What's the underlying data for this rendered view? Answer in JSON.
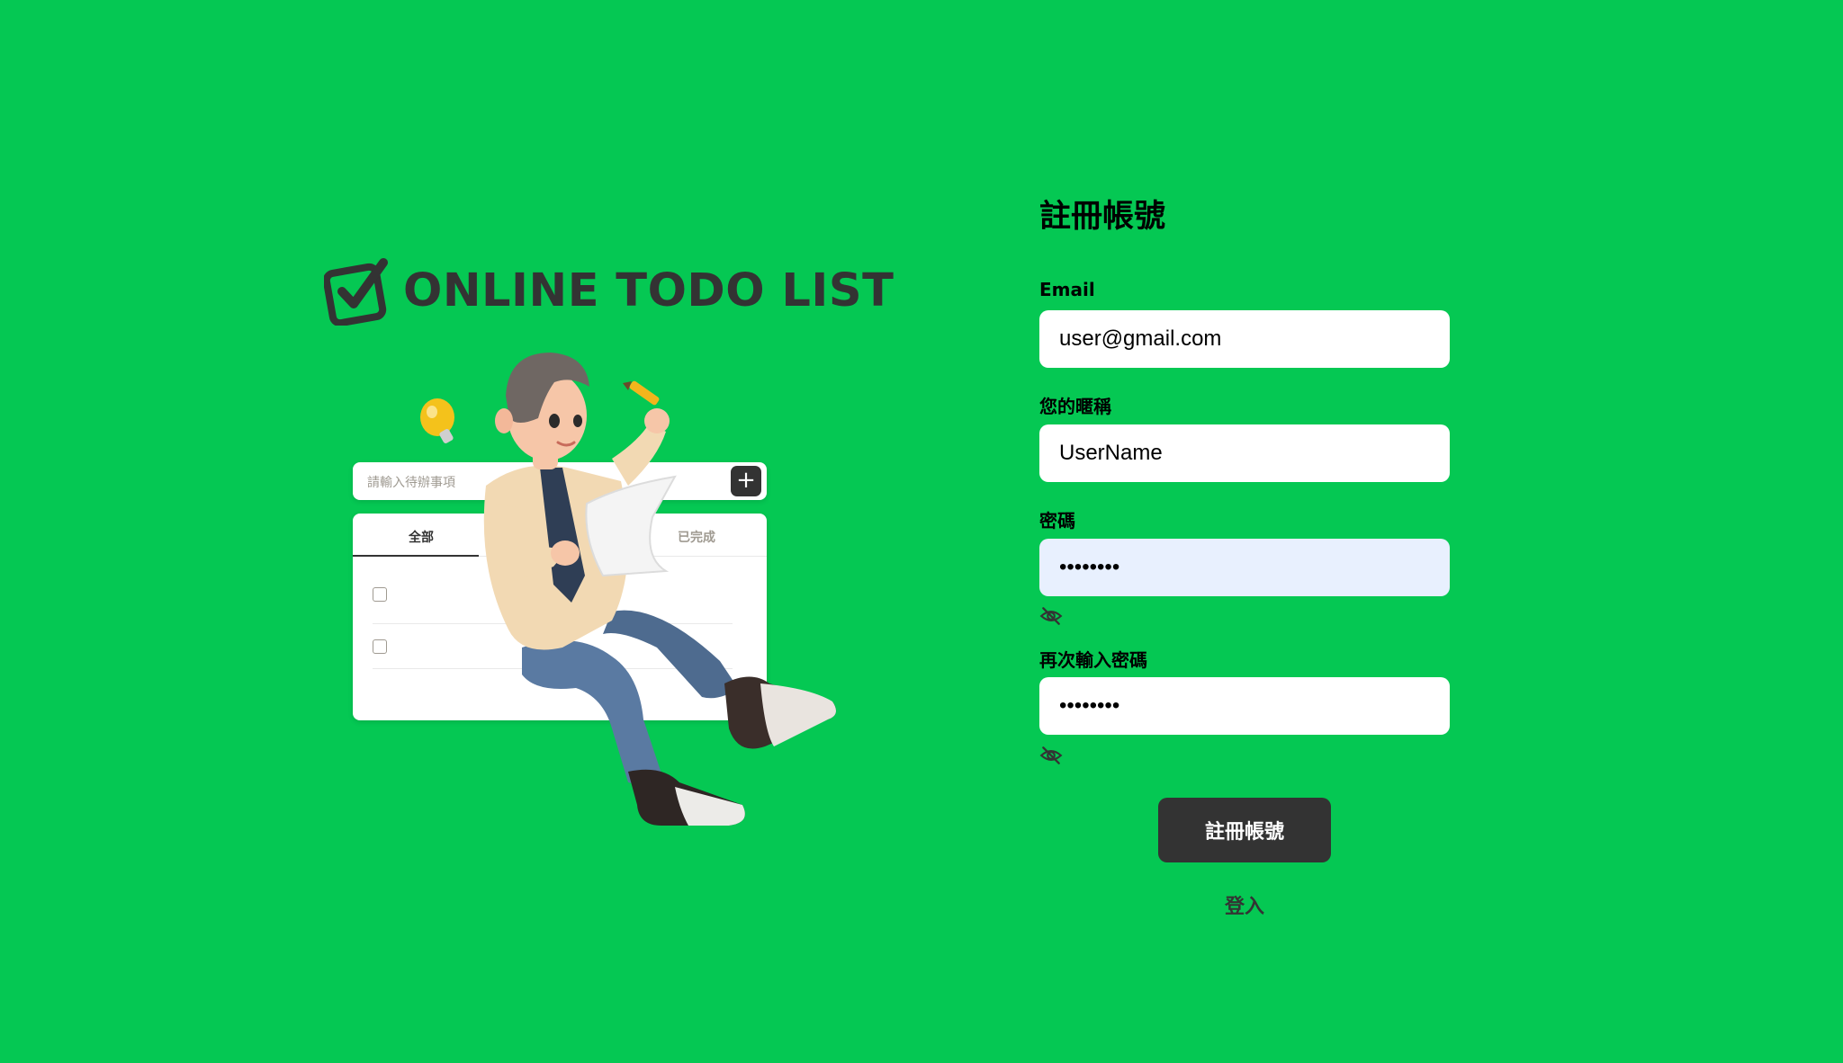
{
  "colors": {
    "background": "#05c853",
    "dark": "#333333",
    "input_background": "#ffffff",
    "autofill_background": "#e8f0fe"
  },
  "brand": {
    "logo_text": "ONLINE TODO LIST",
    "logo_icon": "checkbox-check-icon"
  },
  "illustration": {
    "input_placeholder": "請輸入待辦事項",
    "add_icon": "plus-icon",
    "add_symbol": "+",
    "tabs": [
      "全部",
      "已完成"
    ]
  },
  "form": {
    "title": "註冊帳號",
    "email": {
      "label": "Email",
      "value": "user@gmail.com"
    },
    "nickname": {
      "label": "您的暱稱",
      "value": "UserName"
    },
    "password": {
      "label": "密碼",
      "value": "password",
      "toggle_icon": "eye-slash-icon"
    },
    "confirm_password": {
      "label": "再次輸入密碼",
      "value": "password",
      "toggle_icon": "eye-slash-icon"
    },
    "submit_label": "註冊帳號",
    "login_link": "登入"
  }
}
